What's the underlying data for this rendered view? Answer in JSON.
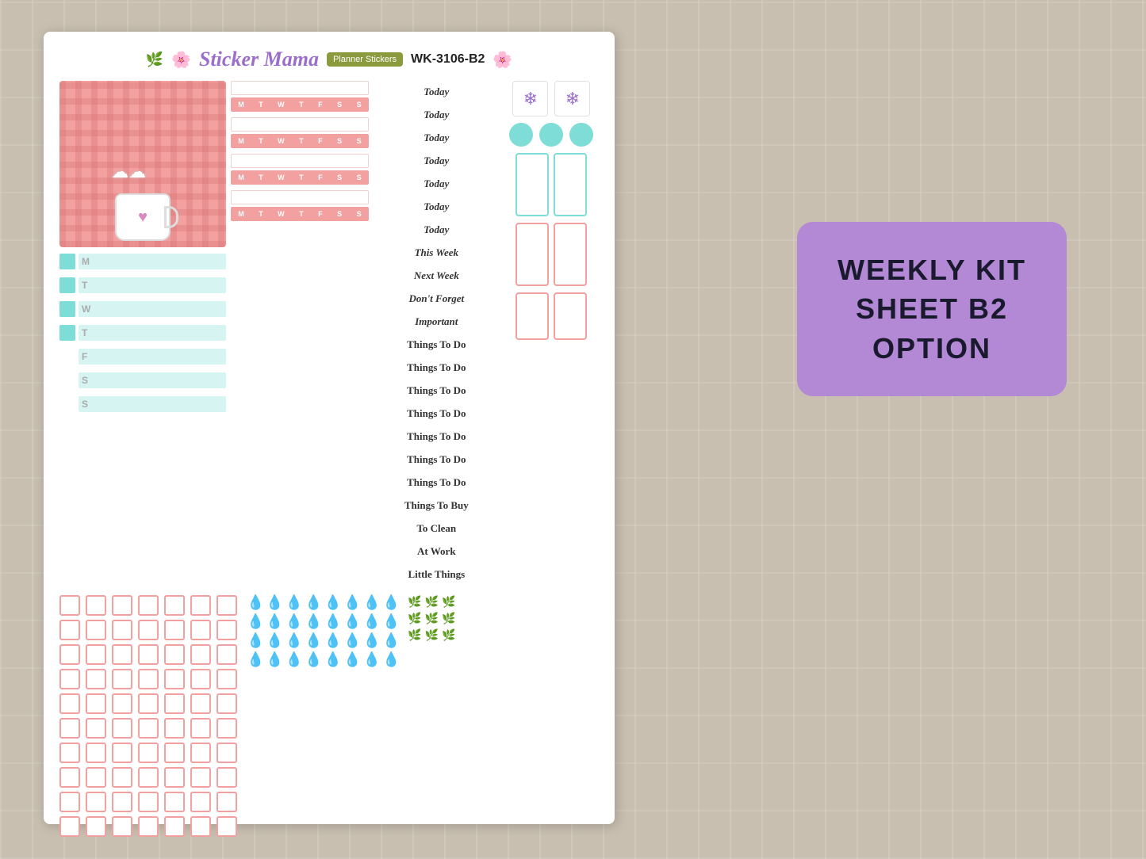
{
  "header": {
    "brand": "Sticker Mama",
    "badge": "Planner Stickers",
    "kit_code": "WK-3106-B2"
  },
  "days": {
    "letters": [
      "M",
      "T",
      "W",
      "T",
      "F",
      "S",
      "S"
    ],
    "rows": [
      {
        "letter": "M"
      },
      {
        "letter": "T"
      },
      {
        "letter": "W"
      },
      {
        "letter": "T"
      },
      {
        "letter": "F"
      },
      {
        "letter": "S"
      },
      {
        "letter": "S"
      }
    ]
  },
  "today_labels": [
    "Today",
    "Today",
    "Today",
    "Today",
    "Today",
    "Today",
    "Today",
    "This Week",
    "Next Week",
    "Don't Forget",
    "Important"
  ],
  "things_labels": [
    "Things To Do",
    "Things To Do",
    "Things To Do",
    "Things To Do",
    "Things To Do",
    "Things To Do",
    "Things To Do",
    "Things To Buy",
    "To Clean",
    "At Work",
    "Little Things"
  ],
  "info": {
    "line1": "WEEKLY KIT",
    "line2": "SHEET B2",
    "line3": "OPTION"
  },
  "cal_days": [
    "M",
    "T",
    "W",
    "T",
    "F",
    "S",
    "S"
  ]
}
